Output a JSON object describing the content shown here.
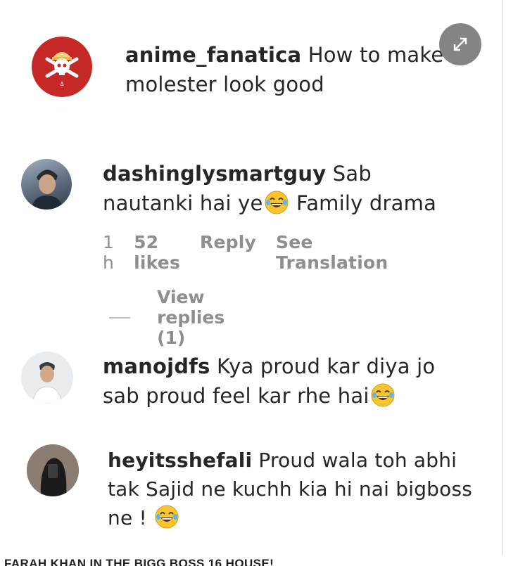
{
  "comments": [
    {
      "username": "anime_fanatica",
      "text": "How to make molester look good"
    },
    {
      "username": "dashinglysmartguy",
      "text_before_emoji": "Sab nautanki hai ye",
      "text_after_emoji": "Family drama",
      "meta": {
        "time": "1 h",
        "likes": "52 likes",
        "reply": "Reply",
        "translation": "See Translation"
      },
      "view_replies": "View replies (1)"
    },
    {
      "username": "manojdfs",
      "text_before_emoji": "Kya proud kar diya jo sab proud feel kar rhe hai"
    },
    {
      "username": "heyitsshefali",
      "text_before_emoji": "Proud wala toh abhi tak Sajid ne kuchh kia hi nai bigboss ne !"
    }
  ],
  "caption": "FARAH KHAN IN THE BIGG BOSS 16 HOUSE!",
  "icons": {
    "expand": "expand-icon",
    "emoji": "laughing-tears-emoji"
  },
  "colors": {
    "text": "#262626",
    "muted": "#8e8e8e",
    "overlay_button": "#6e6e6e",
    "avatar_red": "#c62828"
  }
}
